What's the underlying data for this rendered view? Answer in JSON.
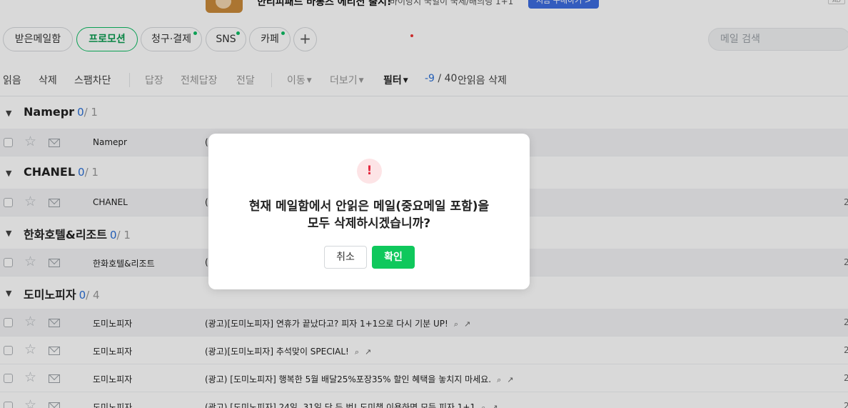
{
  "ad": {
    "title": "한티피패드 바롱즈 에티션 출시!",
    "subtitle": "바이랑지 국일이 국제/배의팅 1+1",
    "button": "지금 구매하기 >",
    "badge": "AD"
  },
  "tabs": [
    {
      "label": "받은메일함",
      "active": false,
      "dot": false
    },
    {
      "label": "프로모션",
      "active": true,
      "dot": false
    },
    {
      "label": "청구·결제",
      "active": false,
      "dot": true
    },
    {
      "label": "SNS",
      "active": false,
      "dot": true
    },
    {
      "label": "카페",
      "active": false,
      "dot": true
    }
  ],
  "add_tab_label": "+",
  "search": {
    "placeholder": "메일 검색"
  },
  "toolbar": {
    "read": "읽음",
    "delete": "삭제",
    "block_spam": "스팸차단",
    "reply": "답장",
    "reply_all": "전체답장",
    "forward": "전달",
    "move": "이동",
    "more": "더보기",
    "filter": "필터",
    "unread_count": "-9",
    "total_count": "/ 40",
    "delete_unread": "안읽음 삭제"
  },
  "groups": [
    {
      "name": "Namepr",
      "unread": "0",
      "total": "/ 1",
      "rows": [
        {
          "sender": "Namepr",
          "subject": "(",
          "date": ""
        }
      ]
    },
    {
      "name": "CHANEL",
      "unread": "0",
      "total": "/ 1",
      "rows": [
        {
          "sender": "CHANEL",
          "subject": "(",
          "date": "2"
        }
      ]
    },
    {
      "name": "한화호텔&리조트",
      "unread": "0",
      "total": "/ 1",
      "rows": [
        {
          "sender": "한화호텔&리조트",
          "subject": "(",
          "date": "2"
        }
      ]
    },
    {
      "name": "도미노피자",
      "unread": "0",
      "total": "/ 4",
      "rows": [
        {
          "sender": "도미노피자",
          "subject": "(광고)[도미노피자] 연휴가 끝났다고? 피자 1+1으로 다시 기분 UP!",
          "date": "2"
        },
        {
          "sender": "도미노피자",
          "subject": "(광고)[도미노피자] 추석맞이 SPECIAL!",
          "date": "2"
        },
        {
          "sender": "도미노피자",
          "subject": "(광고) [도미노피자] 행복한 5월 배달25%포장35% 할인 혜택을 놓치지 마세요.",
          "date": "2"
        },
        {
          "sender": "도미노피자",
          "subject": "(광고) [도미노피자] 24일, 31일 단 두 번! 도미챗 이용하면 모든 피자 1+1",
          "date": "2"
        }
      ]
    }
  ],
  "dialog": {
    "icon": "!",
    "line1": "현재 메일함에서 안읽은 메일(중요메일 포함)을",
    "line2": "모두 삭제하시겠습니까?",
    "cancel": "취소",
    "confirm": "확인"
  },
  "colors": {
    "accent": "#0fc85c",
    "alert": "#e4283e",
    "unread": "#2a6fd6"
  }
}
